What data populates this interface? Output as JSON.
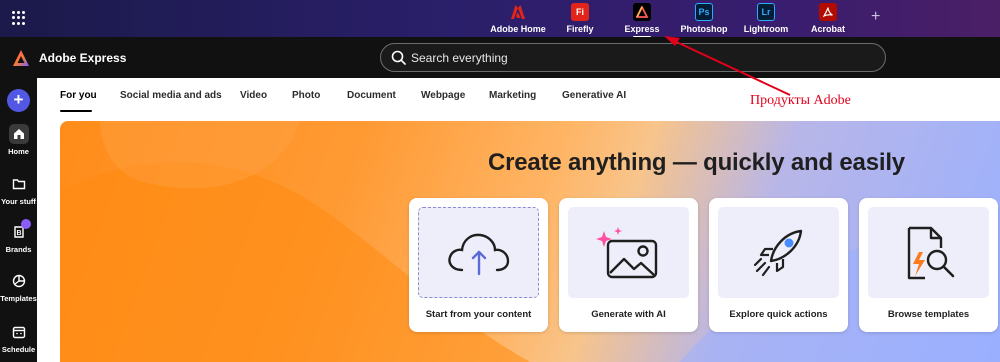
{
  "app_bar": {
    "apps": [
      {
        "label": "Adobe Home",
        "icon": "adobe-logo-icon",
        "color": "#e1251b"
      },
      {
        "label": "Firefly",
        "icon_text": "Fi",
        "color": "#e1251b"
      },
      {
        "label": "Express",
        "icon": "express-logo-icon",
        "color": "#000000",
        "active": true
      },
      {
        "label": "Photoshop",
        "icon_text": "Ps",
        "color": "#001e36"
      },
      {
        "label": "Lightroom",
        "icon_text": "Lr",
        "color": "#001e36"
      },
      {
        "label": "Acrobat",
        "icon": "acrobat-icon",
        "color": "#b30b00"
      }
    ],
    "add_icon": "plus-icon"
  },
  "header": {
    "brand": "Adobe Express",
    "search_placeholder": "Search everything"
  },
  "sidebar": {
    "items": [
      {
        "label": "Home",
        "icon": "home-icon",
        "active": true
      },
      {
        "label": "Your stuff",
        "icon": "folder-icon"
      },
      {
        "label": "Brands",
        "icon": "brand-icon"
      },
      {
        "label": "Templates",
        "icon": "templates-icon"
      },
      {
        "label": "Schedule",
        "icon": "calendar-icon"
      }
    ]
  },
  "tabs": [
    "For you",
    "Social media and ads",
    "Video",
    "Photo",
    "Document",
    "Webpage",
    "Marketing",
    "Generative AI"
  ],
  "hero": {
    "title": "Create anything — quickly and easily",
    "cards": [
      {
        "label": "Start from your content",
        "icon": "cloud-upload-icon"
      },
      {
        "label": "Generate with AI",
        "icon": "ai-image-icon"
      },
      {
        "label": "Explore quick actions",
        "icon": "rocket-icon"
      },
      {
        "label": "Browse templates",
        "icon": "template-search-icon"
      }
    ]
  },
  "annotation": {
    "text": "Продукты Adobe",
    "color": "#e1001a"
  }
}
